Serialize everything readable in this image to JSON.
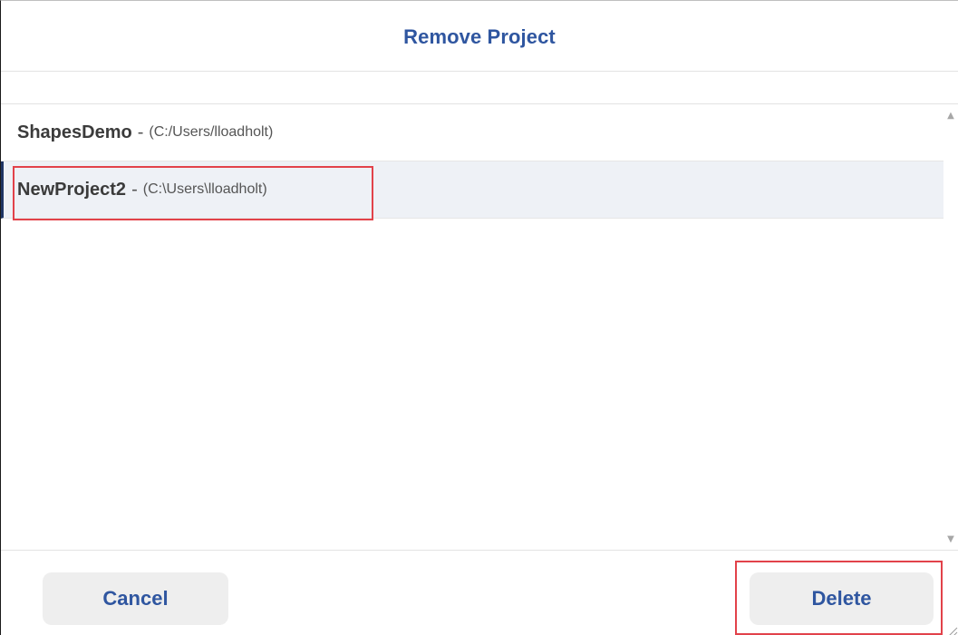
{
  "dialog": {
    "title": "Remove Project"
  },
  "projects": [
    {
      "name": "ShapesDemo",
      "separator": "-",
      "path": "(C:/Users/lloadholt)",
      "selected": false
    },
    {
      "name": "NewProject2",
      "separator": "-",
      "path": "(C:\\Users\\lloadholt)",
      "selected": true
    }
  ],
  "scrollbar": {
    "up_glyph": "▲",
    "down_glyph": "▼"
  },
  "footer": {
    "cancel_label": "Cancel",
    "delete_label": "Delete"
  },
  "colors": {
    "title_text": "#2f56a0",
    "button_text": "#2f56a0",
    "button_bg": "#eeeeee",
    "selected_row_bg": "#eef1f6",
    "selected_row_marker": "#1f3564",
    "annotation_box": "#e2424a"
  },
  "icons": {
    "scroll_up": "scroll-up-arrow-icon",
    "scroll_down": "scroll-down-arrow-icon",
    "resize": "resize-grip-icon"
  }
}
